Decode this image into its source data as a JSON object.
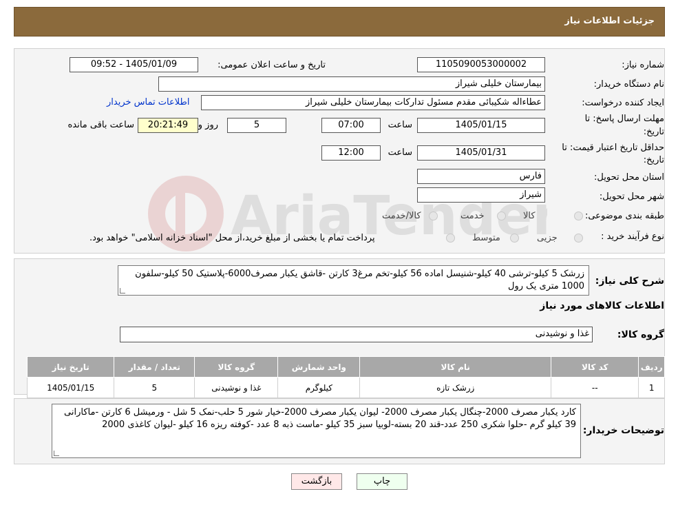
{
  "header": {
    "title": "جزئیات اطلاعات نیاز"
  },
  "form": {
    "need_number_label": "شماره نیاز:",
    "need_number": "1105090053000002",
    "announce_label": "تاریخ و ساعت اعلان عمومی:",
    "announce_value": "1405/01/09 - 09:52",
    "buyer_org_label": "نام دستگاه خریدار:",
    "buyer_org": "بیمارستان خلیلی شیراز",
    "creator_label": "ایجاد کننده درخواست:",
    "creator": "عطاءاله شکیبائی مقدم مسئول تدارکات  بیمارستان خلیلی شیراز",
    "contact_link": "اطلاعات تماس خریدار",
    "deadline_label_1": "مهلت ارسال پاسخ: تا",
    "deadline_label_2": "تاریخ:",
    "deadline_date": "1405/01/15",
    "time_label": "ساعت",
    "deadline_time": "07:00",
    "days_value": "5",
    "days_label": "روز و",
    "remaining_time": "20:21:49",
    "remaining_label": "ساعت باقی مانده",
    "min_valid_label_1": "حداقل تاریخ اعتبار قیمت: تا",
    "min_valid_label_2": "تاریخ:",
    "min_valid_date": "1405/01/31",
    "min_valid_time": "12:00",
    "province_label": "استان محل تحویل:",
    "province": "فارس",
    "city_label": "شهر محل تحویل:",
    "city": "شیراز",
    "category_label": "طبقه بندی موضوعی:",
    "category_options": [
      "کالا",
      "خدمت",
      "کالا/خدمت"
    ],
    "purchase_type_label": "نوع فرآیند خرید :",
    "purchase_options": [
      "جزیی",
      "متوسط"
    ],
    "purchase_note": "پرداخت تمام یا بخشی از مبلغ خرید،از محل \"اسناد خزانه اسلامی\" خواهد بود."
  },
  "summary": {
    "label": "شرح کلی نیاز:",
    "text": "زرشک 5 کیلو-ترشی 40 کیلو-شنیسل اماده 56 کیلو-تخم مرغ3 کارتن -قاشق یکبار مصرف6000-پلاستیک 50 کیلو-سلفون 1000 متری یک رول",
    "goods_info_title": "اطلاعات کالاهای مورد نیاز",
    "goods_group_label": "گروه کالا:",
    "goods_group": "غذا و نوشیدنی"
  },
  "table": {
    "headers": [
      "ردیف",
      "کد کالا",
      "نام کالا",
      "واحد شمارش",
      "گروه کالا",
      "تعداد / مقدار",
      "تاریخ نیاز"
    ],
    "rows": [
      [
        "1",
        "--",
        "زرشک تازه",
        "کیلوگرم",
        "غذا و نوشیدنی",
        "5",
        "1405/01/15"
      ]
    ]
  },
  "buyer_notes": {
    "label": "توضیحات خریدار:",
    "text": "کارد یکبار مصرف 2000-چنگال یکبار مصرف 2000- لیوان یکبار مصرف 2000-خیار شور 5 حلب-نمک 5 شل - ورمیشل 6 کارتن -ماکارانی 39 کیلو گرم -حلوا شکری 250 عدد-قند 20 بسته-لوبیا سبز 35 کیلو -ماست ذبه 8 عدد -کوفته ریزه 16 کیلو -لیوان کاغذی 2000"
  },
  "buttons": {
    "print": "چاپ",
    "back": "بازگشت"
  },
  "watermark": {
    "text": "AriaTender.neT"
  },
  "colors": {
    "header_bg": "#8b6a3c",
    "table_header_bg": "#a8a8a8",
    "back_button_bg": "#ffe8e8",
    "print_button_bg": "#efffef"
  }
}
